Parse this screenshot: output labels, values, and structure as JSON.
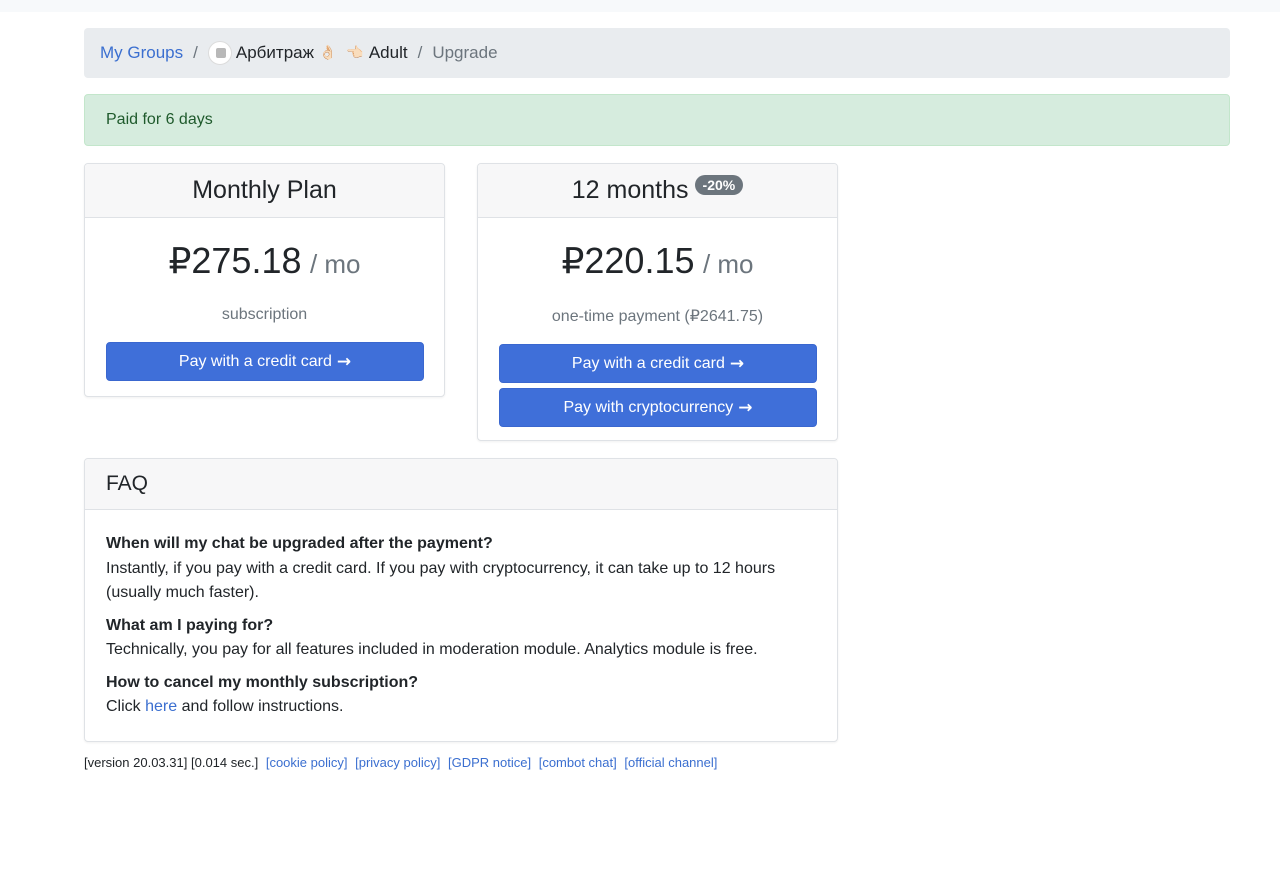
{
  "breadcrumb": {
    "my_groups": "My Groups",
    "separator": "/",
    "group_name_prefix": "Арбитраж",
    "group_emoji_1": "👌🏻",
    "group_emoji_2": "👈🏻",
    "group_name_suffix": "Adult",
    "current": "Upgrade"
  },
  "alert": {
    "text": "Paid for 6 days"
  },
  "plans": [
    {
      "title": "Monthly Plan",
      "price": "₽275.18",
      "per": "/ mo",
      "note": "subscription",
      "buttons": [
        "Pay with a credit card"
      ]
    },
    {
      "title": "12 months",
      "badge": "-20%",
      "price": "₽220.15",
      "per": "/ mo",
      "note": "one-time payment (₽2641.75)",
      "buttons": [
        "Pay with a credit card",
        "Pay with cryptocurrency"
      ]
    }
  ],
  "faq": {
    "title": "FAQ",
    "items": [
      {
        "q": "When will my chat be upgraded after the payment?",
        "a": "Instantly, if you pay with a credit card. If you pay with cryptocurrency, it can take up to 12 hours (usually much faster)."
      },
      {
        "q": "What am I paying for?",
        "a": "Technically, you pay for all features included in moderation module. Analytics module is free."
      },
      {
        "q": "How to cancel my monthly subscription?",
        "a_prefix": "Click",
        "a_link": "here",
        "a_suffix": "and follow instructions."
      }
    ]
  },
  "footer": {
    "version": "[version 20.03.31]",
    "time": "[0.014 sec.]",
    "links": [
      "[cookie policy]",
      "[privacy policy]",
      "[GDPR notice]",
      "[combot chat]",
      "[official channel]"
    ]
  },
  "icons": {
    "arrow": "arrow-right-icon"
  },
  "colors": {
    "primary": "#3f6fd9",
    "link": "#3b6fd0",
    "alert_bg": "#d6ecde",
    "badge": "#6c757d"
  }
}
